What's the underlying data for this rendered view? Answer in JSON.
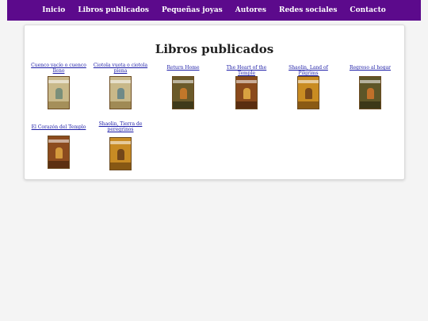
{
  "nav": {
    "items": [
      {
        "label": "Inicio"
      },
      {
        "label": "Libros publicados"
      },
      {
        "label": "Pequeñas joyas"
      },
      {
        "label": "Autores"
      },
      {
        "label": "Redes sociales"
      },
      {
        "label": "Contacto"
      }
    ]
  },
  "page": {
    "title": "Libros publicados"
  },
  "books": [
    {
      "title": "Cuenco vacío o cuenco lleno",
      "cover_color": "#c9b98a",
      "figure_color": "#7a8f7a",
      "base_color": "#a58f5a"
    },
    {
      "title": "Ciotola vuota o ciotola piena",
      "cover_color": "#c8b889",
      "figure_color": "#6f8a88",
      "base_color": "#a08a55"
    },
    {
      "title": "Return Home",
      "cover_color": "#6b5a2a",
      "figure_color": "#c2772a",
      "base_color": "#3f3a1a"
    },
    {
      "title": "The Heart of the Temple",
      "cover_color": "#8a4a1c",
      "figure_color": "#d9a240",
      "base_color": "#5a2e10"
    },
    {
      "title": "Shaolin, Land of Pilgrims",
      "cover_color": "#c98c22",
      "figure_color": "#7a4a1a",
      "base_color": "#8a5a14"
    },
    {
      "title": "Regreso al hogar",
      "cover_color": "#5e5628",
      "figure_color": "#c0702a",
      "base_color": "#3c3818"
    },
    {
      "title": "El Corazón del Templo",
      "cover_color": "#8c4b1e",
      "figure_color": "#d4993c",
      "base_color": "#5c3012"
    },
    {
      "title": "Shaolin, Tierra de peregrinos",
      "cover_color": "#c88b24",
      "figure_color": "#74471a",
      "base_color": "#875814"
    }
  ]
}
